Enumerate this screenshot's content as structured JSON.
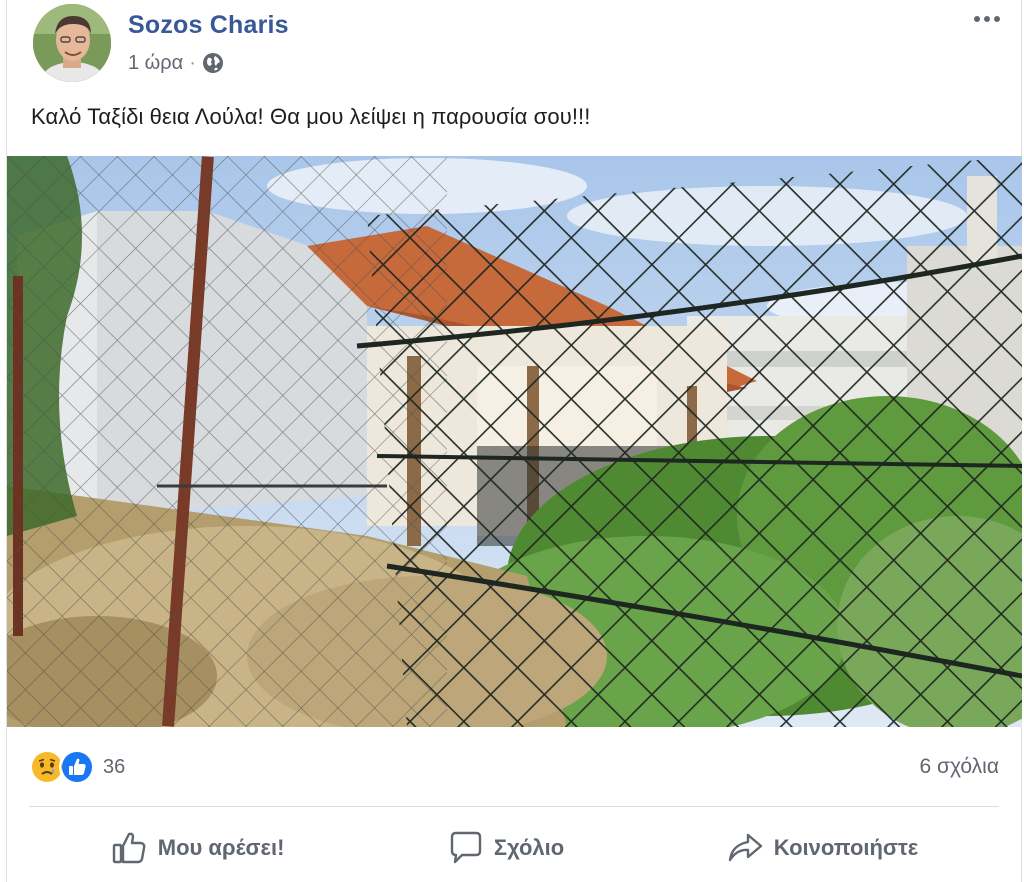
{
  "post": {
    "author": "Sozos Charis",
    "time": "1 ώρα",
    "separator": "·",
    "privacy_icon": "globe-icon",
    "text": "Καλό Ταξίδι θεια Λούλα! Θα μου λείψει η παρουσία σου!!!"
  },
  "reactions": {
    "icons": [
      "sad-reaction-icon",
      "like-reaction-icon"
    ],
    "count": "36",
    "comments": "6 σχόλια"
  },
  "actions": {
    "like_label": "Μου αρέσει!",
    "comment_label": "Σχόλιο",
    "share_label": "Κοινοποιήστε"
  },
  "colors": {
    "author": "#385898",
    "meta": "#616770",
    "like_blue": "#1877f2",
    "sad_yellow": "#f7b928"
  }
}
